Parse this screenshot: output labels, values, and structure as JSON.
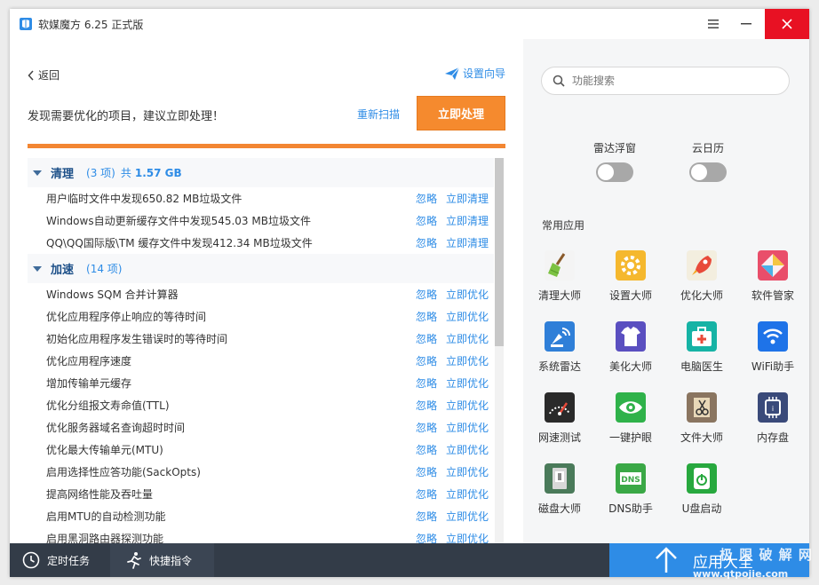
{
  "title": {
    "app_title": "软媒魔方 6.25 正式版"
  },
  "header": {
    "back_label": "返回",
    "wizard_label": "设置向导",
    "prompt": "发现需要优化的项目，建议立即处理！",
    "rescan_label": "重新扫描",
    "process_label": "立即处理",
    "progress_percent": 100
  },
  "groups": [
    {
      "title": "清理",
      "count": "(3 项)",
      "total_label": "共",
      "total_size": "1.57 GB",
      "items": [
        {
          "text": "用户临时文件中发现650.82 MB垃圾文件",
          "ignore": "忽略",
          "action": "立即清理"
        },
        {
          "text": "Windows自动更新缓存文件中发现545.03 MB垃圾文件",
          "ignore": "忽略",
          "action": "立即清理"
        },
        {
          "text": "QQ\\QQ国际版\\TM 缓存文件中发现412.34 MB垃圾文件",
          "ignore": "忽略",
          "action": "立即清理"
        }
      ]
    },
    {
      "title": "加速",
      "count": "(14 项)",
      "items": [
        {
          "text": "Windows SQM 合并计算器",
          "ignore": "忽略",
          "action": "立即优化"
        },
        {
          "text": "优化应用程序停止响应的等待时间",
          "ignore": "忽略",
          "action": "立即优化"
        },
        {
          "text": "初始化应用程序发生错误时的等待时间",
          "ignore": "忽略",
          "action": "立即优化"
        },
        {
          "text": "优化应用程序速度",
          "ignore": "忽略",
          "action": "立即优化"
        },
        {
          "text": "增加传输单元缓存",
          "ignore": "忽略",
          "action": "立即优化"
        },
        {
          "text": "优化分组报文寿命值(TTL)",
          "ignore": "忽略",
          "action": "立即优化"
        },
        {
          "text": "优化服务器域名查询超时时间",
          "ignore": "忽略",
          "action": "立即优化"
        },
        {
          "text": "优化最大传输单元(MTU)",
          "ignore": "忽略",
          "action": "立即优化"
        },
        {
          "text": "启用选择性应答功能(SackOpts)",
          "ignore": "忽略",
          "action": "立即优化"
        },
        {
          "text": "提高网络性能及吞吐量",
          "ignore": "忽略",
          "action": "立即优化"
        },
        {
          "text": "启用MTU的自动检测功能",
          "ignore": "忽略",
          "action": "立即优化"
        },
        {
          "text": "启用黑洞路由器探测功能",
          "ignore": "忽略",
          "action": "立即优化"
        }
      ]
    }
  ],
  "sidebar": {
    "search_placeholder": "功能搜索",
    "toggles": [
      {
        "label": "雷达浮窗",
        "on": false
      },
      {
        "label": "云日历",
        "on": false
      }
    ],
    "apps_title": "常用应用",
    "apps": [
      {
        "label": "清理大师",
        "icon": "broom-icon",
        "color": "#f4f4f4"
      },
      {
        "label": "设置大师",
        "icon": "gear-icon",
        "color": "#f5b82e"
      },
      {
        "label": "优化大师",
        "icon": "rocket-icon",
        "color": "#f3eedf"
      },
      {
        "label": "软件管家",
        "icon": "diamond-icon",
        "color": "#e94e6a"
      },
      {
        "label": "系统雷达",
        "icon": "radar-icon",
        "color": "#2f7fd8"
      },
      {
        "label": "美化大师",
        "icon": "tshirt-icon",
        "color": "#5a4fc0"
      },
      {
        "label": "电脑医生",
        "icon": "first-aid-kit-icon",
        "color": "#16b3a5"
      },
      {
        "label": "WiFi助手",
        "icon": "wifi-icon",
        "color": "#1e73e8"
      },
      {
        "label": "网速测试",
        "icon": "speedometer-icon",
        "color": "#2a2a2a"
      },
      {
        "label": "一键护眼",
        "icon": "eye-icon",
        "color": "#2fb24a"
      },
      {
        "label": "文件大师",
        "icon": "file-scissors-icon",
        "color": "#8a7560"
      },
      {
        "label": "内存盘",
        "icon": "chip-icon",
        "color": "#3a4a7a"
      },
      {
        "label": "磁盘大师",
        "icon": "disk-icon",
        "color": "#4a7a5a"
      },
      {
        "label": "DNS助手",
        "icon": "dns-icon",
        "color": "#3aa846"
      },
      {
        "label": "U盘启动",
        "icon": "usb-power-icon",
        "color": "#27a83e"
      }
    ]
  },
  "bottom": {
    "timer_label": "定时任务",
    "quick_label": "快捷指令",
    "app_center_label": "应用大全"
  },
  "watermark": {
    "line1": "极 限 破 解 网",
    "line2": "www.qtpojie.com"
  }
}
